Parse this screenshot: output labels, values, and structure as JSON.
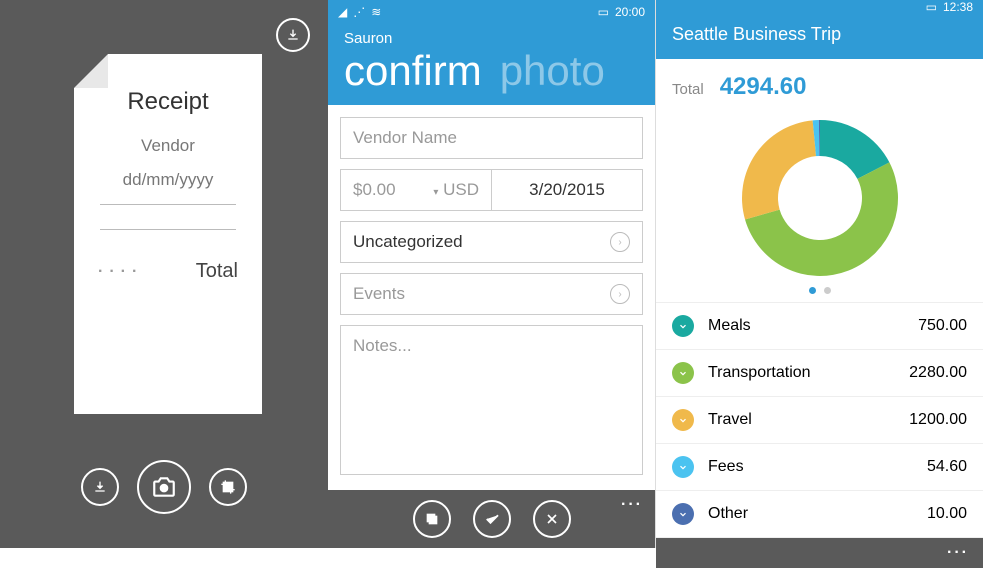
{
  "panel1": {
    "receipt_title": "Receipt",
    "vendor_label": "Vendor",
    "date_placeholder": "dd/mm/yyyy",
    "dots": "····",
    "total_label": "Total"
  },
  "panel2": {
    "status_time": "20:00",
    "app_name": "Sauron",
    "tab_confirm": "confirm",
    "tab_photo": "photo",
    "vendor_placeholder": "Vendor Name",
    "amount_value": "$0.00",
    "currency": "USD",
    "date_value": "3/20/2015",
    "category_value": "Uncategorized",
    "events_label": "Events",
    "notes_placeholder": "Notes...",
    "ellipsis": "···"
  },
  "panel3": {
    "status_time": "12:38",
    "title": "Seattle Business Trip",
    "total_label": "Total",
    "total_value": "4294.60",
    "categories": [
      {
        "name": "Meals",
        "value": "750.00",
        "color": "#1aa9a0"
      },
      {
        "name": "Transportation",
        "value": "2280.00",
        "color": "#8bc34a"
      },
      {
        "name": "Travel",
        "value": "1200.00",
        "color": "#f0b94b"
      },
      {
        "name": "Fees",
        "value": "54.60",
        "color": "#4bc3f0"
      },
      {
        "name": "Other",
        "value": "10.00",
        "color": "#4b6fb0"
      }
    ],
    "ellipsis": "···"
  },
  "chart_data": {
    "type": "pie",
    "title": "Seattle Business Trip",
    "total": 4294.6,
    "series": [
      {
        "name": "Meals",
        "value": 750.0,
        "color": "#1aa9a0"
      },
      {
        "name": "Transportation",
        "value": 2280.0,
        "color": "#8bc34a"
      },
      {
        "name": "Travel",
        "value": 1200.0,
        "color": "#f0b94b"
      },
      {
        "name": "Fees",
        "value": 54.6,
        "color": "#4bc3f0"
      },
      {
        "name": "Other",
        "value": 10.0,
        "color": "#4b6fb0"
      }
    ]
  }
}
